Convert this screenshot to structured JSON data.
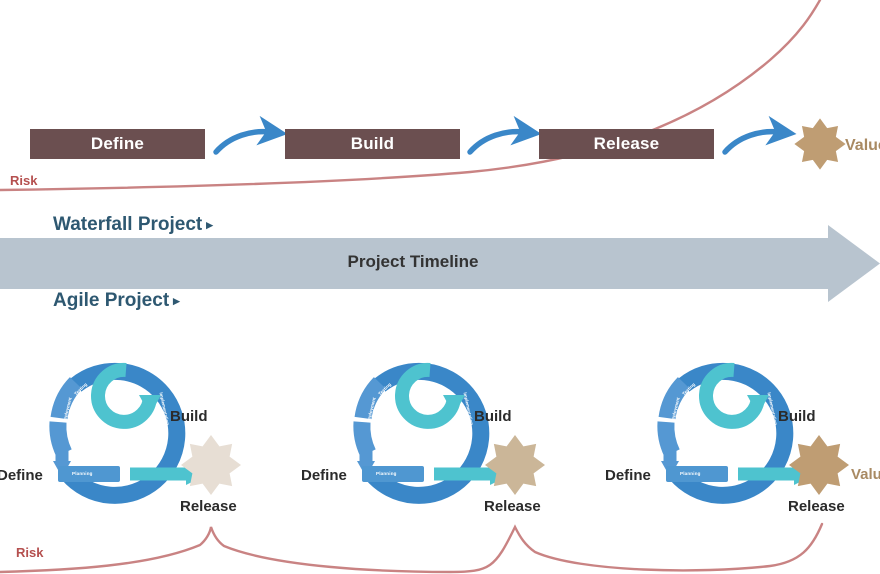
{
  "diagram": {
    "title_waterfall": "Waterfall Project",
    "title_agile": "Agile Project",
    "caret": "▸",
    "timeline_label": "Project Timeline",
    "risk_label": "Risk",
    "value_label": "Value"
  },
  "colors": {
    "phase_box": "#6b4f50",
    "phase_box_text": "#ffffff",
    "arrow_blue": "#3a87c8",
    "arrow_cyan": "#4ec3cf",
    "risk_curve": "#c98383",
    "risk_text": "#b5504f",
    "timeline_bar": "#b8c4cf",
    "timeline_text": "#333333",
    "heading_text": "#2e5871",
    "value_text": "#a98a63",
    "star_light": "#e7ded4",
    "star_mid": "#cbb698",
    "star_dark": "#bf9d73",
    "cycle_blue_dark": "#3a87c8",
    "cycle_blue_mid": "#4f97d1",
    "cycle_cyan": "#4ec3cf",
    "cycle_label": "#2b2b2b",
    "background": "#ffffff"
  },
  "waterfall": {
    "phases": [
      {
        "label": "Define"
      },
      {
        "label": "Build"
      },
      {
        "label": "Release"
      }
    ],
    "outcome": {
      "shape": "star-8",
      "label": "Value"
    },
    "risk": {
      "label": "Risk",
      "shape": "rising-exponential-curve",
      "description": "Risk accumulates steadily and spikes near the single end release"
    }
  },
  "timeline": {
    "label": "Project Timeline",
    "shape": "right-arrow-bar"
  },
  "agile": {
    "iterations": [
      {
        "define_label": "Define",
        "build_label": "Build",
        "release_label": "Release",
        "star_tone": "light",
        "segments": [
          {
            "label": "Planning"
          },
          {
            "label": "Deployment"
          },
          {
            "label": "Testing"
          },
          {
            "label": "Implementation"
          }
        ]
      },
      {
        "define_label": "Define",
        "build_label": "Build",
        "release_label": "Release",
        "star_tone": "mid",
        "segments": [
          {
            "label": "Planning"
          },
          {
            "label": "Deployment"
          },
          {
            "label": "Testing"
          },
          {
            "label": "Implementation"
          }
        ]
      },
      {
        "define_label": "Define",
        "build_label": "Build",
        "release_label": "Release",
        "star_tone": "dark",
        "segments": [
          {
            "label": "Planning"
          },
          {
            "label": "Deployment"
          },
          {
            "label": "Testing"
          },
          {
            "label": "Implementation"
          }
        ]
      }
    ],
    "outcome": {
      "shape": "star-8",
      "label": "Value"
    },
    "risk": {
      "label": "Risk",
      "shape": "repeating-peaks-curve",
      "description": "Risk is released in small repeated peaks at each iteration release"
    }
  }
}
